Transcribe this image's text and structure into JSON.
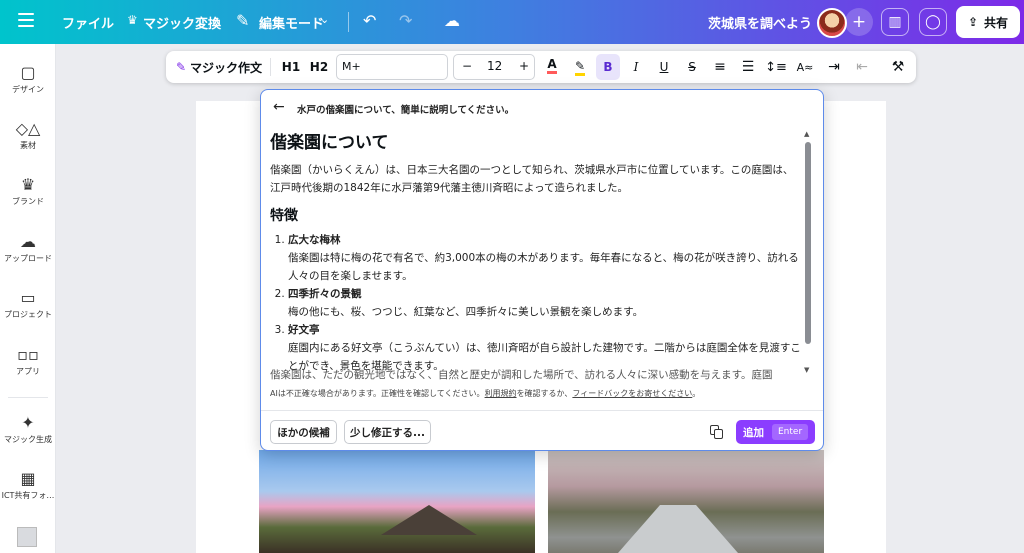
{
  "topbar": {
    "file": "ファイル",
    "magic_switch": "マジック変換",
    "edit_mode": "編集モード",
    "doc_title": "茨城県を調べよう",
    "share": "共有"
  },
  "sidebar": {
    "items": [
      {
        "label": "デザイン",
        "icon": "design-icon"
      },
      {
        "label": "素材",
        "icon": "elements-icon"
      },
      {
        "label": "ブランド",
        "icon": "brand-icon"
      },
      {
        "label": "アップロード",
        "icon": "upload-icon"
      },
      {
        "label": "プロジェクト",
        "icon": "folder-icon"
      },
      {
        "label": "アプリ",
        "icon": "apps-icon"
      },
      {
        "label": "マジック生成",
        "icon": "magic-media-icon"
      },
      {
        "label": "ICT共有フォ…",
        "icon": "shared-folder-icon"
      }
    ]
  },
  "format_toolbar": {
    "magic_write": "マジック作文",
    "h1": "H1",
    "h2": "H2",
    "font": "M+",
    "minus": "−",
    "size": "12",
    "plus": "+",
    "bold": "B",
    "italic": "I",
    "underline": "U",
    "strike": "S"
  },
  "ai_panel": {
    "prompt": "水戸の偕楽園について、簡単に説明してください。",
    "heading": "偕楽園について",
    "intro": "偕楽園（かいらくえん）は、日本三大名園の一つとして知られ、茨城県水戸市に位置しています。この庭園は、江戸時代後期の1842年に水戸藩第9代藩主徳川斉昭によって造られました。",
    "features_heading": "特徴",
    "features": [
      {
        "title": "広大な梅林",
        "text": "偕楽園は特に梅の花で有名で、約3,000本の梅の木があります。毎年春になると、梅の花が咲き誇り、訪れる人々の目を楽しませます。"
      },
      {
        "title": "四季折々の景観",
        "text": "梅の他にも、桜、つつじ、紅葉など、四季折々に美しい景観を楽しめます。"
      },
      {
        "title": "好文亭",
        "text": "庭園内にある好文亭（こうぶんてい）は、徳川斉昭が自ら設計した建物です。二階からは庭園全体を見渡すことができ、景色を堪能できます。"
      }
    ],
    "fade_text": "偕楽園は、ただの観光地ではなく、自然と歴史が調和した場所で、訪れる人々に深い感動を与えます。庭園",
    "disclaimer_prefix": "AIは不正確な場合があります。正確性を確認してください。",
    "terms_link": "利用規約",
    "disclaimer_mid": "を確認するか、",
    "feedback_link": "フィードバックをお寄せください",
    "disclaimer_end": "。",
    "other_options": "ほかの候補",
    "revise": "少し修正する...",
    "add": "追加",
    "enter": "Enter"
  }
}
